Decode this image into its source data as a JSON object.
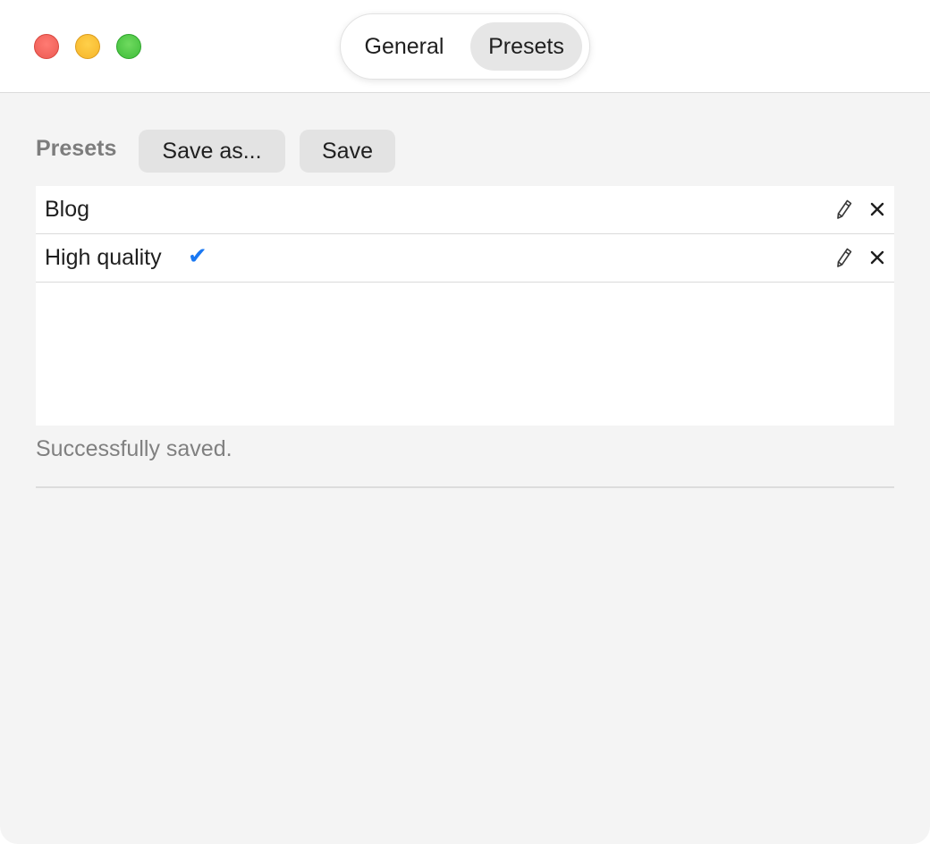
{
  "window": {
    "controls": [
      "close",
      "minimize",
      "maximize"
    ]
  },
  "tabs": [
    {
      "label": "General",
      "selected": false
    },
    {
      "label": "Presets",
      "selected": true
    }
  ],
  "presets_panel": {
    "heading": "Presets",
    "save_as_label": "Save as...",
    "save_label": "Save",
    "items": [
      {
        "name": "Blog",
        "checked": false,
        "check_glyph": ""
      },
      {
        "name": "High quality",
        "checked": true,
        "check_glyph": "✔"
      }
    ],
    "status": "Successfully saved."
  },
  "colors": {
    "accent": "#1a78f2",
    "background": "#f4f4f4"
  },
  "icons": {
    "edit": "pencil-icon",
    "delete": "close-x-icon",
    "selected": "checkmark-icon"
  }
}
